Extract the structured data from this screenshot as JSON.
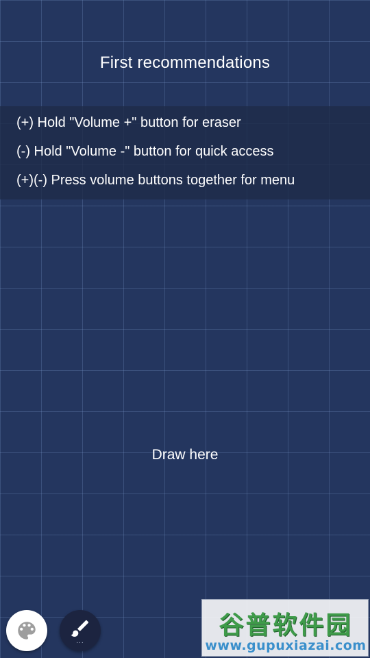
{
  "header": {
    "title": "First recommendations"
  },
  "tips": [
    {
      "text": "(+) Hold \"Volume +\" button for eraser"
    },
    {
      "text": "(-) Hold \"Volume -\" button for quick access"
    },
    {
      "text": "(+)(-) Press volume buttons together for menu"
    }
  ],
  "canvas": {
    "hint": "Draw here",
    "background_color": "#24365f",
    "grid_color": "#4a5f8f"
  },
  "toolbar": {
    "palette_icon": "palette-icon",
    "brush_icon": "brush-icon",
    "brush_indicator": "..."
  },
  "watermark": {
    "title": "谷普软件园",
    "url": "www.gupuxiazai.com"
  }
}
